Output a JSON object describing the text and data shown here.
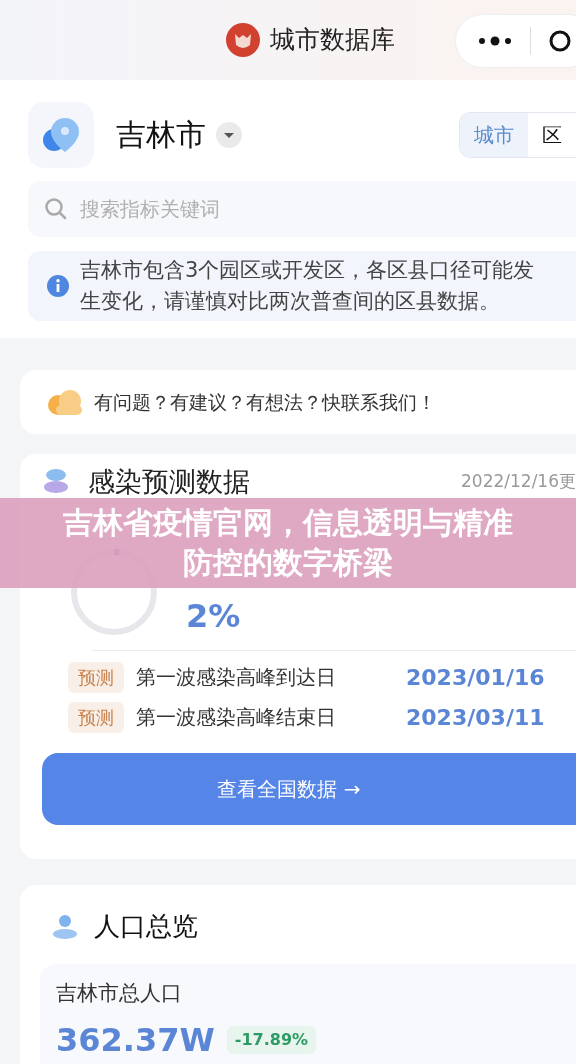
{
  "header": {
    "title": "城市数据库"
  },
  "city": {
    "name": "吉林市"
  },
  "scope_tabs": [
    {
      "label": "城市",
      "selected": true
    },
    {
      "label": "区",
      "selected": false
    }
  ],
  "search": {
    "placeholder": "搜索指标关键词"
  },
  "notice": "吉林市包含3个园区或开发区，各区县口径可能发生变化，请谨慎对比两次普查间的区县数据。",
  "feedback": "有问题？有建议？有想法？快联系我们！",
  "prediction": {
    "title": "感染预测数据",
    "updated": "2022/12/16更",
    "ring": {
      "level": 0.02,
      "value": "2%"
    },
    "rows": [
      {
        "tag": "预测",
        "label": "第一波感染高峰到达日",
        "date": "2023/01/16"
      },
      {
        "tag": "预测",
        "label": "第一波感染高峰结束日",
        "date": "2023/03/11"
      }
    ],
    "button": "查看全国数据 →"
  },
  "population": {
    "title": "人口总览",
    "label": "吉林市总人口",
    "value": "362.37W",
    "change": "-17.89%"
  },
  "banner": "吉林省疫情官网，信息透明与精准防控的数字桥梁"
}
